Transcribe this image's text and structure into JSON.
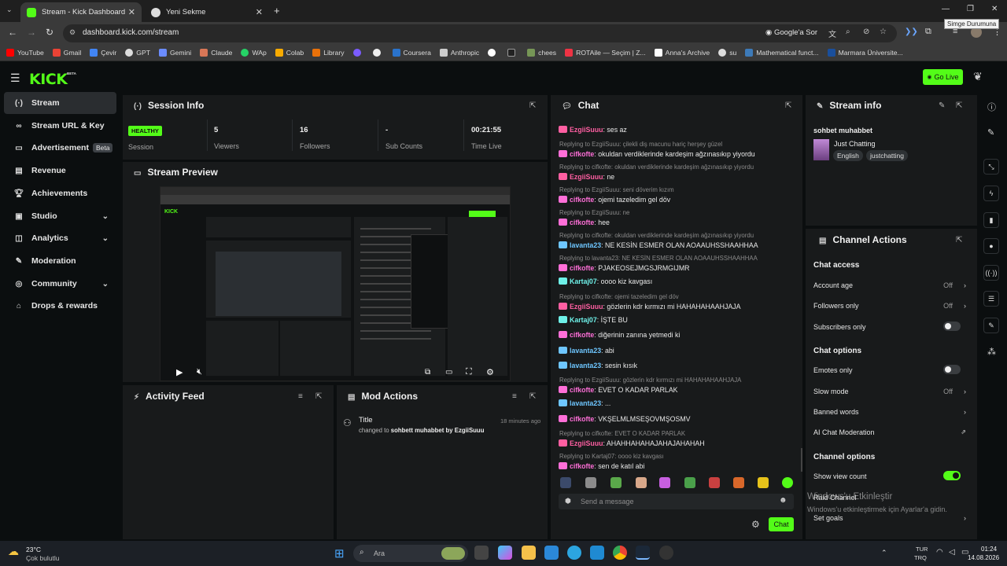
{
  "browser": {
    "tabs": [
      {
        "title": "Stream - Kick Dashboard",
        "active": true
      },
      {
        "title": "Yeni Sekme",
        "active": false
      }
    ],
    "url": "dashboard.kick.com/stream",
    "google_lens_label": "Google'a Sor",
    "tooltip": "Simge Durumuna",
    "bookmarks": [
      "YouTube",
      "Gmail",
      "Çevir",
      "GPT",
      "Gemini",
      "Claude",
      "WAp",
      "Colab",
      "Library",
      "",
      "",
      "Coursera",
      "Anthropic",
      "",
      "",
      "chees",
      "ROTAile — Seçim | Z...",
      "Anna's Archive",
      "su",
      "Mathematical funct...",
      "Marmara Üniversite..."
    ]
  },
  "header": {
    "logo": "KICK",
    "beta": "BETA",
    "go_live": "Go Live"
  },
  "sidebar": {
    "items": [
      {
        "label": "Stream",
        "icon": "broadcast-icon"
      },
      {
        "label": "Stream URL & Key",
        "icon": "link-icon"
      },
      {
        "label": "Advertisement",
        "icon": "ad-icon",
        "badge": "Beta"
      },
      {
        "label": "Revenue",
        "icon": "chart-icon"
      },
      {
        "label": "Achievements",
        "icon": "trophy-icon"
      },
      {
        "label": "Studio",
        "icon": "studio-icon"
      },
      {
        "label": "Analytics",
        "icon": "analytics-icon"
      },
      {
        "label": "Moderation",
        "icon": "wrench-icon"
      },
      {
        "label": "Community",
        "icon": "community-icon"
      },
      {
        "label": "Drops & rewards",
        "icon": "gift-icon"
      }
    ]
  },
  "session": {
    "title": "Session Info",
    "status": "HEALTHY",
    "stats": [
      {
        "value": "",
        "label": "Session"
      },
      {
        "value": "5",
        "label": "Viewers"
      },
      {
        "value": "16",
        "label": "Followers"
      },
      {
        "value": "-",
        "label": "Sub Counts"
      },
      {
        "value": "00:21:55",
        "label": "Time Live"
      }
    ]
  },
  "preview": {
    "title": "Stream Preview"
  },
  "activity": {
    "title": "Activity Feed"
  },
  "mod_actions": {
    "title": "Mod Actions",
    "entry": {
      "title": "Title",
      "time": "18 minutes ago",
      "text_prefix": "changed to ",
      "text_value": "sohbett muhabbet by EzgiiSuuu"
    }
  },
  "chat": {
    "title": "Chat",
    "colors": {
      "EzgiiSuuu": "#ff5fa2",
      "cifkofte": "#ff6fd8",
      "lavanta23": "#6ec6ff",
      "Kartaj07": "#6ef0e8"
    },
    "messages": [
      {
        "user": "EzgiiSuuu",
        "text": "ses az"
      },
      {
        "reply": "Replying to EzgiiSuuu: çilekli diş macunu hariç herşey güzel",
        "user": "cifkofte",
        "text": "okuldan verdiklerinde kardeşim ağzınasıkıp yiyordu"
      },
      {
        "reply": "Replying to cifkofte: okuldan verdiklerinde kardeşim ağzınasıkıp yiyordu",
        "user": "EzgiiSuuu",
        "text": "ne"
      },
      {
        "reply": "Replying to EzgiiSuuu: seni döverim kızım",
        "user": "cifkofte",
        "text": "ojemi tazeledim gel döv"
      },
      {
        "reply": "Replying to EzgiiSuuu: ne",
        "user": "cifkofte",
        "text": "hee"
      },
      {
        "reply": "Replying to cifkofte: okuldan verdiklerinde kardeşim ağzınasıkıp yiyordu",
        "user": "lavanta23",
        "text": "NE KESİN ESMER OLAN AOAAUHSSHAAHHAA"
      },
      {
        "reply": "Replying to lavanta23: NE KESİN ESMER OLAN AOAAUHSSHAAHHAA",
        "user": "cifkofte",
        "text": "PJAKEOSEJMGSJRMGIJMR"
      },
      {
        "user": "Kartaj07",
        "text": "oooo kiz kavgası"
      },
      {
        "reply": "Replying to cifkofte: ojemi tazeledim gel döv",
        "user": "EzgiiSuuu",
        "text": "gözlerin kdr kırmızı mi HAHAHAHAAHJAJA"
      },
      {
        "user": "Kartaj07",
        "text": "İŞTE BU"
      },
      {
        "user": "cifkofte",
        "text": "diğerinin zanına yetmedi ki"
      },
      {
        "user": "lavanta23",
        "text": "abi"
      },
      {
        "user": "lavanta23",
        "text": "sesin kısık"
      },
      {
        "reply": "Replying to EzgiiSuuu: gözlerin kdr kırmızı mi HAHAHAHAAHJAJA",
        "user": "cifkofte",
        "text": "EVET O KADAR PARLAK"
      },
      {
        "user": "lavanta23",
        "text": "..."
      },
      {
        "user": "cifkofte",
        "text": "VKŞELMLMSEŞOVMŞOSMV"
      },
      {
        "reply": "Replying to cifkofte: EVET O KADAR PARLAK",
        "user": "EzgiiSuuu",
        "text": "AHAHHAHAHAJAHAJAHAHAH"
      },
      {
        "reply": "Replying to Kartaj07: oooo kiz kavgası",
        "user": "cifkofte",
        "text": "sen de katıl abi"
      }
    ],
    "placeholder": "Send a message",
    "send_label": "Chat"
  },
  "stream_info": {
    "title": "Stream info",
    "stream_title": "sohbet muhabbet",
    "category": "Just Chatting",
    "tags": [
      "English",
      "justchatting"
    ]
  },
  "channel_actions": {
    "title": "Channel Actions",
    "chat_access": "Chat access",
    "account_age": {
      "label": "Account age",
      "value": "Off"
    },
    "followers_only": {
      "label": "Followers only",
      "value": "Off"
    },
    "subscribers_only": {
      "label": "Subscribers only",
      "on": false
    },
    "chat_options": "Chat options",
    "emotes_only": {
      "label": "Emotes only",
      "on": false
    },
    "slow_mode": {
      "label": "Slow mode",
      "value": "Off"
    },
    "banned_words": "Banned words",
    "ai_moderation": "AI Chat Moderation",
    "channel_options": "Channel options",
    "show_view_count": {
      "label": "Show view count",
      "on": true
    },
    "raid_channel": "Raid Channel",
    "set_goals": "Set goals"
  },
  "watermark": {
    "line1": "Windows'u Etkinleştir",
    "line2": "Windows'u etkinleştirmek için Ayarlar'a gidin."
  },
  "taskbar": {
    "weather_temp": "23°C",
    "weather_text": "Çok bulutlu",
    "search_placeholder": "Ara",
    "lang": "TUR",
    "lang2": "TRQ",
    "time": "01:24",
    "date": "14.08.2026"
  }
}
